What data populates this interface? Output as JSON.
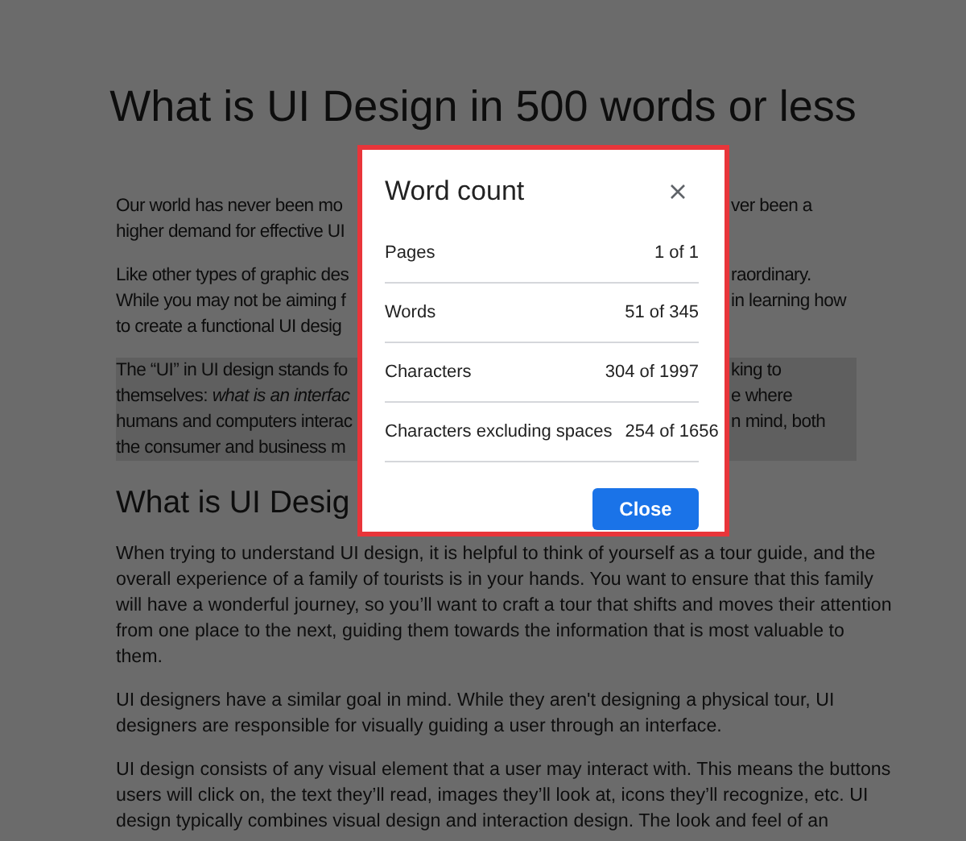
{
  "document": {
    "title": "What is UI Design in 500 words or less",
    "blocks": [
      {
        "kind": "paragraph",
        "highlighted": false,
        "lines": [
          {
            "left": "Our world has never been mo",
            "right": "ver been a"
          },
          {
            "left": "higher demand for effective UI"
          }
        ]
      },
      {
        "kind": "paragraph",
        "highlighted": false,
        "lines": [
          {
            "left": "Like other types of graphic des",
            "right": "raordinary."
          },
          {
            "left": "While you may not be aiming f",
            "right": "in learning how"
          },
          {
            "left": "to create a functional UI desig"
          }
        ]
      },
      {
        "kind": "paragraph",
        "highlighted": true,
        "lines": [
          {
            "left": "The “UI” in UI design stands fo",
            "right": "king to"
          },
          {
            "left": "themselves: *what is an interfac*",
            "right": "e where"
          },
          {
            "left": "humans and computers interac",
            "right": "n mind, both"
          },
          {
            "left": "the consumer and business m"
          }
        ]
      },
      {
        "kind": "heading",
        "highlighted": false,
        "lines": [
          {
            "left": "What is UI Desig"
          }
        ]
      },
      {
        "kind": "paragraph",
        "highlighted": false,
        "lines": [
          {
            "left": "When trying to understand UI design, it is helpful to think of yourself as a tour guide, and the"
          },
          {
            "left": "overall experience of a family of tourists is in your hands. You want to ensure that this family"
          },
          {
            "left": "will have a wonderful journey, so you’ll want to craft a tour that shifts and moves their attention"
          },
          {
            "left": "from one place to the next, guiding them towards the information that is most valuable to"
          },
          {
            "left": "them."
          }
        ]
      },
      {
        "kind": "paragraph",
        "highlighted": false,
        "lines": [
          {
            "left": "UI designers have a similar goal in mind. While they aren't designing a physical tour, UI"
          },
          {
            "left": "designers are responsible for visually guiding a user through an interface."
          }
        ]
      },
      {
        "kind": "paragraph",
        "highlighted": false,
        "lines": [
          {
            "left": "UI design consists of any visual element that a user may interact with. This means the buttons"
          },
          {
            "left": "users will click on, the text they’ll read, images they’ll look at, icons they’ll recognize, etc. UI"
          },
          {
            "left": "design typically combines visual design and interaction design. The look and feel of an"
          }
        ]
      }
    ]
  },
  "dialog": {
    "title": "Word count",
    "rows": [
      {
        "label": "Pages",
        "value": "1 of 1"
      },
      {
        "label": "Words",
        "value": "51 of 345"
      },
      {
        "label": "Characters",
        "value": "304 of 1997"
      },
      {
        "label": "Characters excluding spaces",
        "value": "254 of 1656"
      }
    ],
    "button": "Close"
  }
}
